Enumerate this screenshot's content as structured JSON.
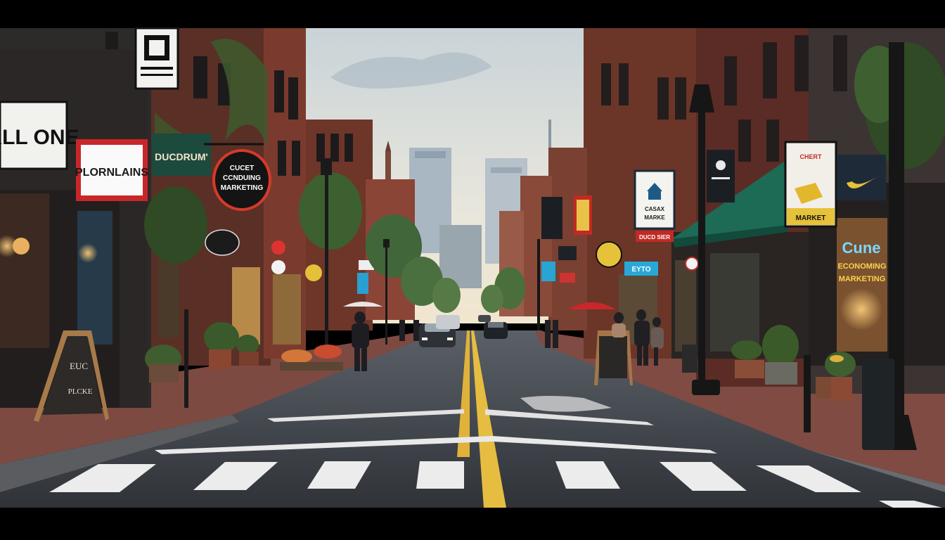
{
  "scene": {
    "description_free": true,
    "colors": {
      "sky_top": "#cfd6da",
      "sky_bottom": "#efe7d6",
      "brick": "#7a3a2c",
      "brick_dark": "#4e2a22",
      "awning_green": "#1f6b55",
      "road": "#3b3f45",
      "sidewalk": "#8a4e44",
      "lane_yellow": "#e3b93a",
      "letterbox": "#000000"
    }
  },
  "signs": {
    "left_all_one": "ALL ONE",
    "left_plornlains": "PLORNLAINS",
    "left_ducdrum": "DUCDRUM'",
    "left_marketing_line1": "CUCET",
    "left_marketing_line2": "CCNDUING",
    "left_marketing_line3": "MARKETING",
    "left_chalkboard_line1": "EUC",
    "left_chalkboard_line2": "PLCKE",
    "right_cozy_line1": "CASAX",
    "right_cozy_line2": "MARKE",
    "right_red_banner": "DUCD SIER",
    "right_cozy_line3": "CHERT",
    "right_cozy_line4": "MARKET",
    "right_neon_line1": "Cune",
    "right_neon_line2": "ECONOMING",
    "right_neon_line3": "MARKETING",
    "right_cyan_small": "EYTO"
  }
}
